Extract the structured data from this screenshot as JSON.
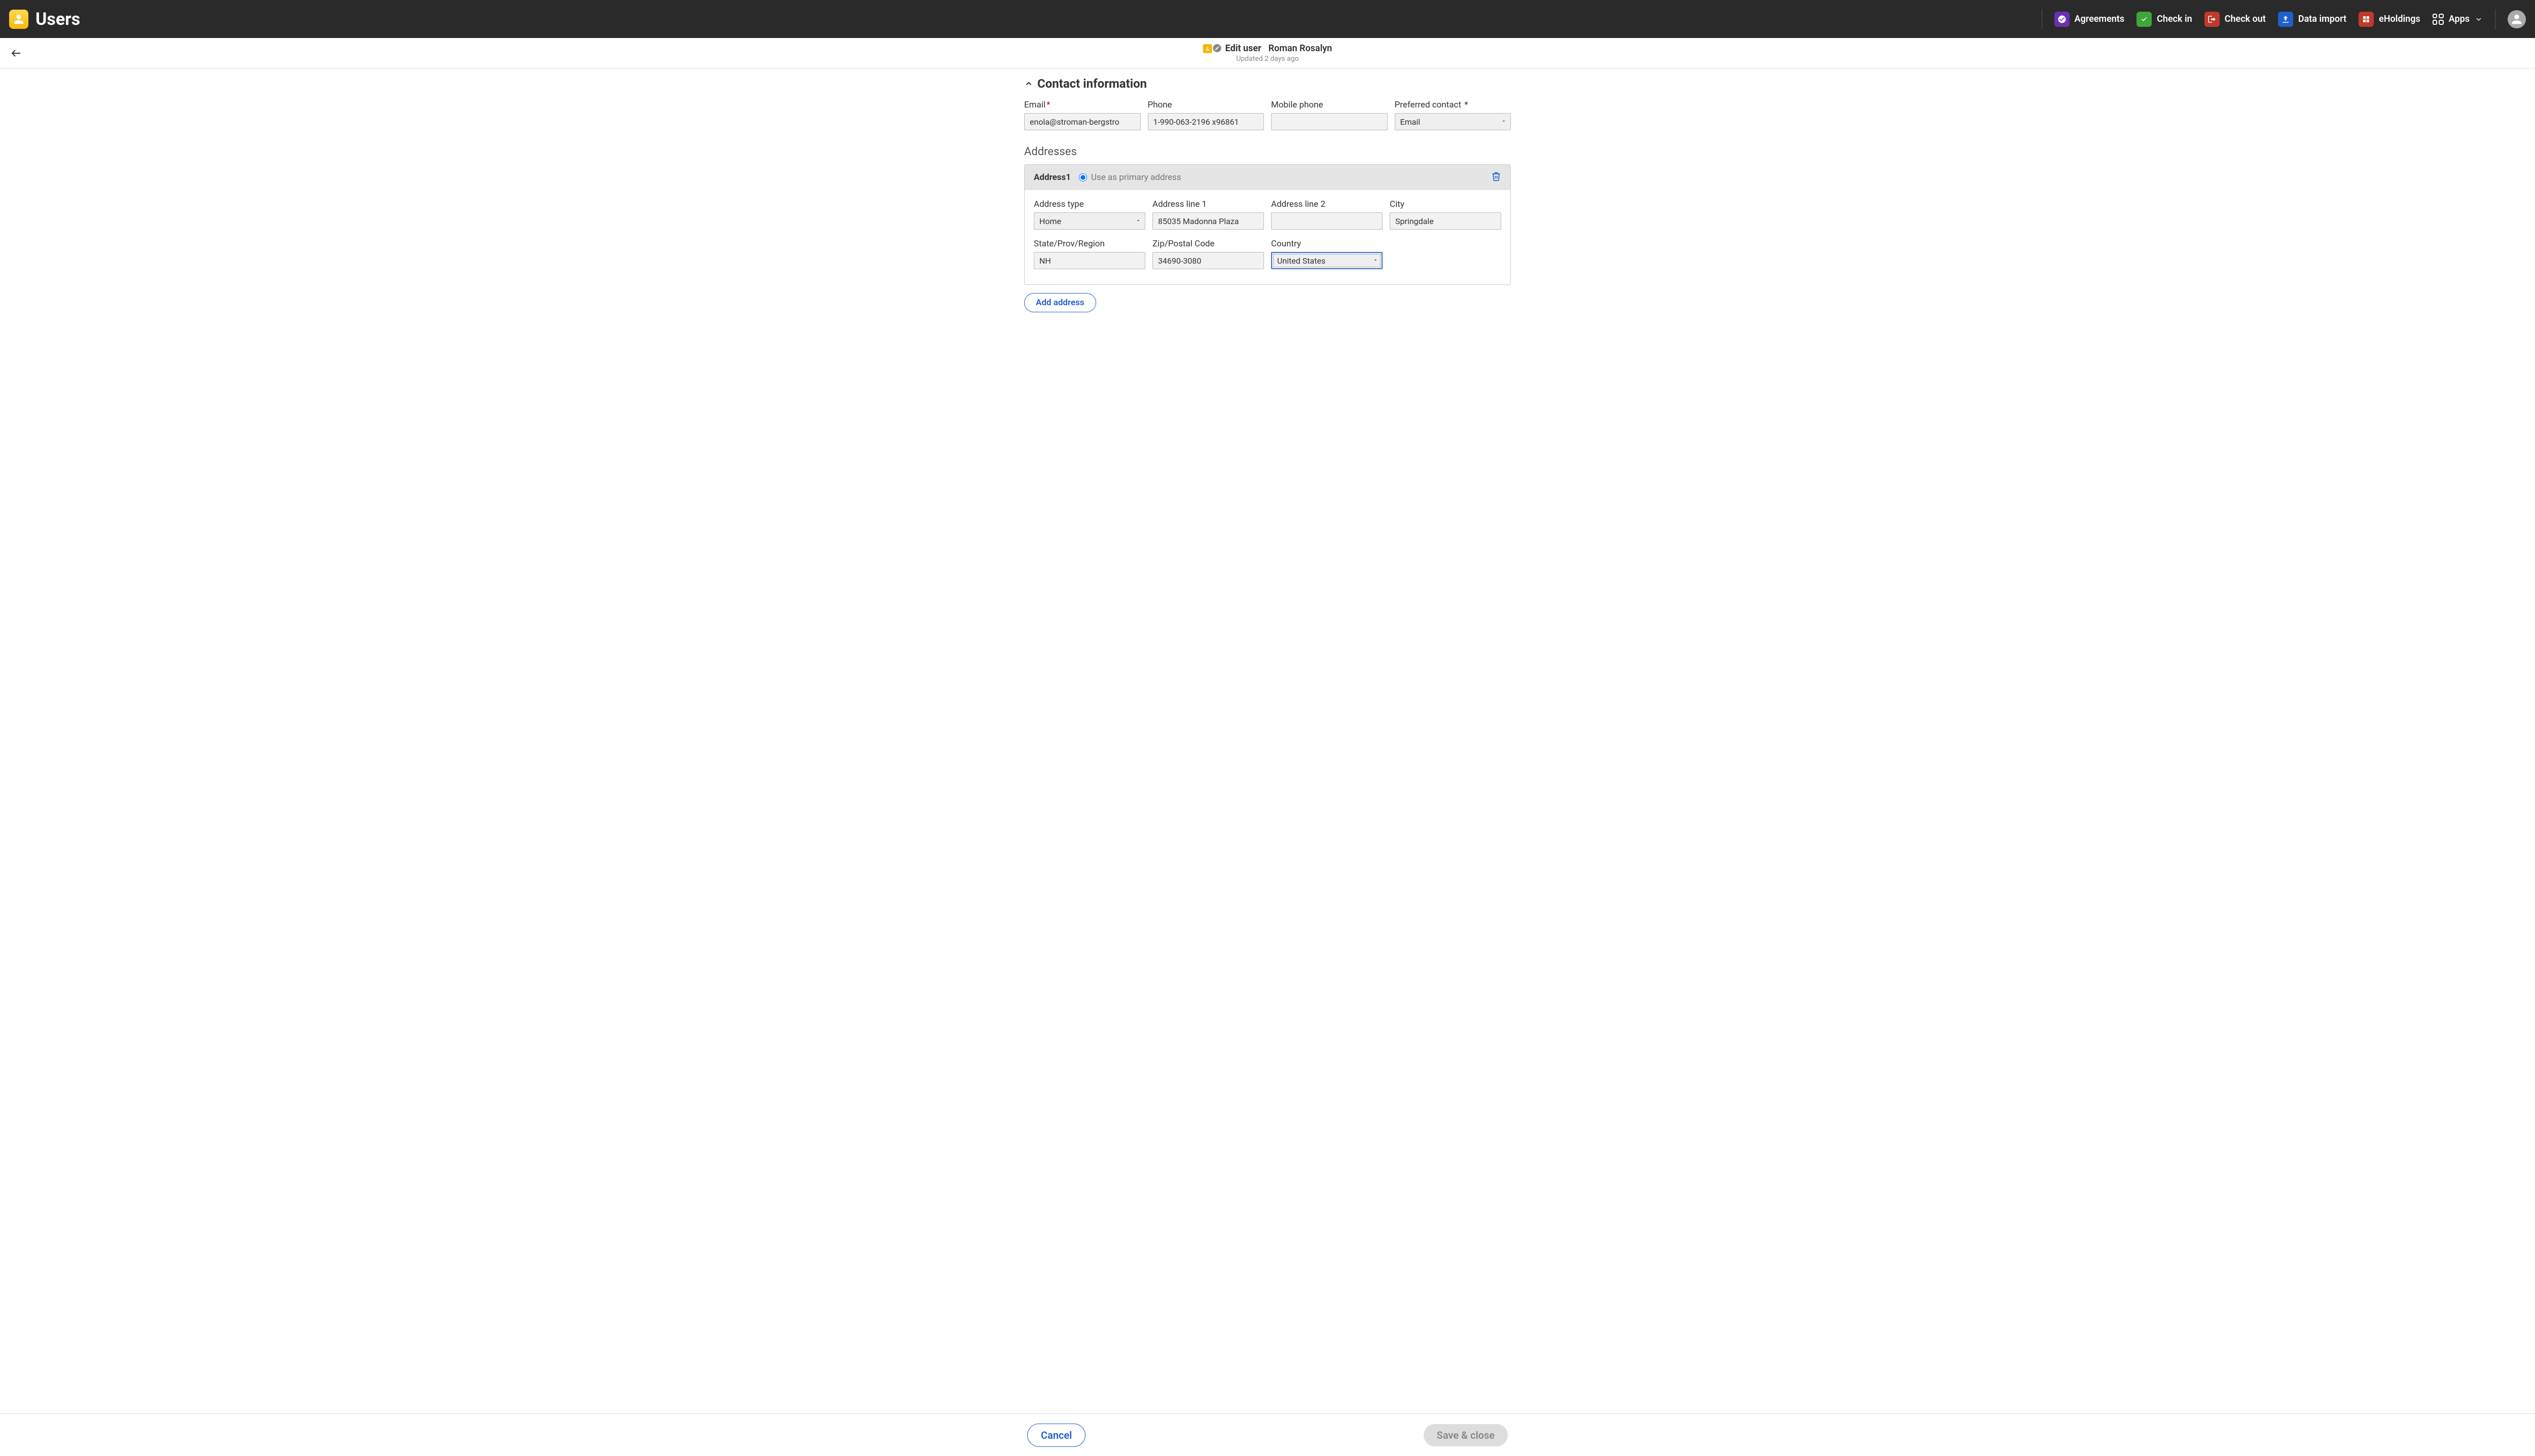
{
  "app": {
    "title": "Users"
  },
  "nav": {
    "agreements": "Agreements",
    "checkin": "Check in",
    "checkout": "Check out",
    "dataimport": "Data import",
    "eholdings": "eHoldings",
    "apps": "Apps"
  },
  "subheader": {
    "edit": "Edit user",
    "name": "Roman Rosalyn",
    "updated": "Updated 2 days ago"
  },
  "section": {
    "title": "Contact information"
  },
  "labels": {
    "email": "Email",
    "phone": "Phone",
    "mobile": "Mobile phone",
    "preferred": "Preferred contact",
    "addresses": "Addresses",
    "addrtype": "Address type",
    "line1": "Address line 1",
    "line2": "Address line 2",
    "city": "City",
    "state": "State/Prov/Region",
    "zip": "Zip/Postal Code",
    "country": "Country",
    "addr1": "Address1",
    "primary": "Use as primary address",
    "addaddr": "Add address",
    "cancel": "Cancel",
    "save": "Save & close"
  },
  "values": {
    "email": "enola@stroman-bergstro",
    "phone": "1-990-063-2196 x96861",
    "mobile": "",
    "preferred": "Email",
    "addresses": [
      {
        "type": "Home",
        "line1": "85035 Madonna Plaza",
        "line2": "",
        "city": "Springdale",
        "state": "NH",
        "zip": "34690-3080",
        "country": "United States"
      }
    ]
  }
}
